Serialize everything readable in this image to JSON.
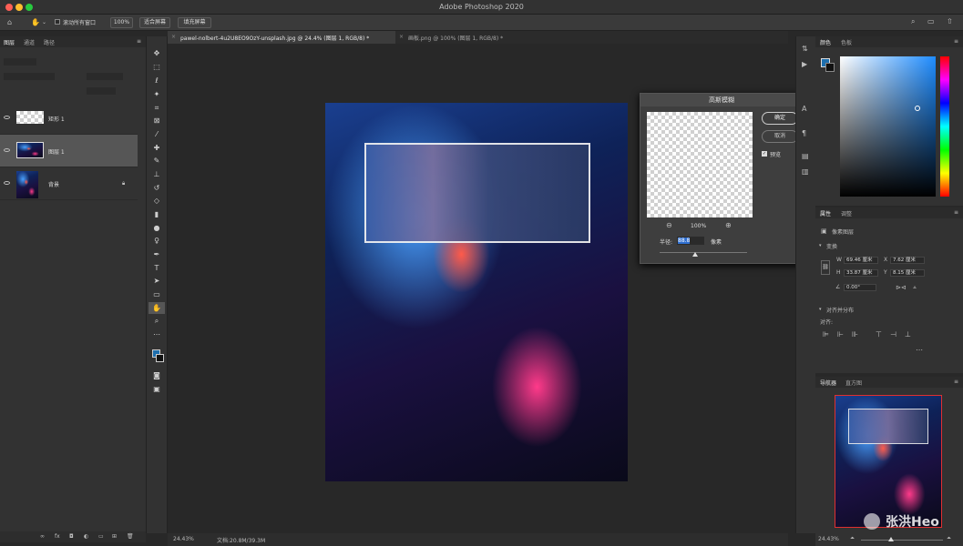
{
  "window": {
    "title": "Adobe Photoshop 2020",
    "traffic_lights": [
      "#ff5f56",
      "#ffbd2e",
      "#27c93f"
    ]
  },
  "options_bar": {
    "scroll_all_label": "滚动所有窗口",
    "zoom_value": "100%",
    "fit_screen_label": "适合屏幕",
    "fill_screen_label": "填充屏幕"
  },
  "doc_tabs": [
    {
      "label": "pawel-nolbert-4u2U8EO9OzY-unsplash.jpg @ 24.4% (图层 1, RGB/8) *",
      "active": true
    },
    {
      "label": "画板.png @ 100% (图层 1, RGB/8) *",
      "active": false
    }
  ],
  "layers_panel": {
    "tabs": [
      "图层",
      "通道",
      "路径"
    ],
    "layers": [
      {
        "name": "矩形 1",
        "thumb": "checker",
        "selected": false
      },
      {
        "name": "图层 1",
        "thumb": "city",
        "selected": true
      },
      {
        "name": "背景",
        "thumb": "city",
        "selected": false,
        "locked": true
      }
    ]
  },
  "gaussian_blur": {
    "title": "高斯模糊",
    "ok_label": "确定",
    "cancel_label": "取消",
    "preview_label": "预览",
    "preview_checked": true,
    "zoom_value": "100%",
    "radius_label": "半径:",
    "radius_value": "88.8",
    "radius_unit": "像素",
    "slider_fraction": 0.41
  },
  "color_panel": {
    "tabs": [
      "颜色",
      "色板"
    ],
    "foreground": "#1e6fae",
    "background": "#111111"
  },
  "properties_panel": {
    "tabs": [
      "属性",
      "调整"
    ],
    "type_label": "像素图层",
    "transform_label": "变换",
    "w_label": "W",
    "w_value": "69.46 厘米",
    "h_label": "H",
    "h_value": "33.87 厘米",
    "x_label": "X",
    "x_value": "7.62 厘米",
    "y_label": "Y",
    "y_value": "8.15 厘米",
    "angle_value": "0.00°",
    "align_section_label": "对齐并分布",
    "align_label": "对齐:"
  },
  "navigator_panel": {
    "tabs": [
      "导航器",
      "直方图"
    ],
    "zoom_value": "24.43%"
  },
  "status_bar": {
    "zoom_value": "24.43%",
    "doc_info": "文档:20.8M/39.3M"
  },
  "watermark": {
    "text": "张洪Heo"
  }
}
